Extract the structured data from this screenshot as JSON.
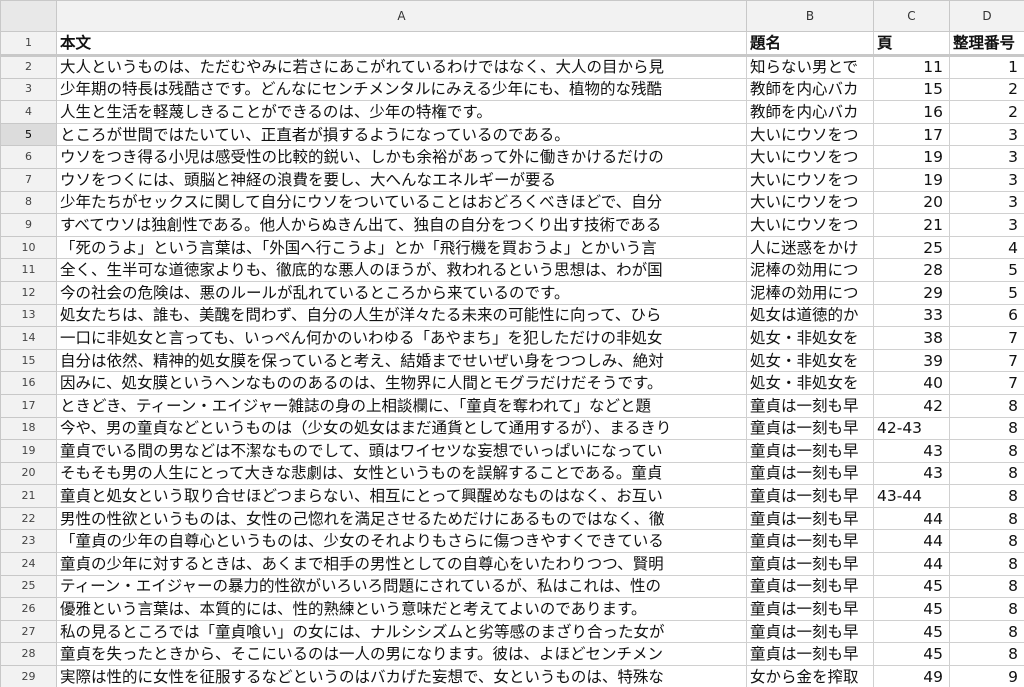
{
  "column_headers": [
    "A",
    "B",
    "C",
    "D"
  ],
  "header_row": {
    "row": "1",
    "a": "本文",
    "b": "題名",
    "c": "頁",
    "d": "整理番号"
  },
  "rows": [
    {
      "row": "2",
      "a": "大人というものは、ただむやみに若さにあこがれているわけではなく、大人の目から見",
      "b": "知らない男とで",
      "c": "11",
      "d": "1"
    },
    {
      "row": "3",
      "a": "少年期の特長は残酷さです。どんなにセンチメンタルにみえる少年にも、植物的な残酷",
      "b": "教師を内心バカ",
      "c": "15",
      "d": "2"
    },
    {
      "row": "4",
      "a": "人生と生活を軽蔑しきることができるのは、少年の特権です。",
      "b": "教師を内心バカ",
      "c": "16",
      "d": "2"
    },
    {
      "row": "5",
      "a": "ところが世間ではたいてい、正直者が損するようになっているのである。",
      "b": "大いにウソをつ",
      "c": "17",
      "d": "3"
    },
    {
      "row": "6",
      "a": "ウソをつき得る小児は感受性の比較的鋭い、しかも余裕があって外に働きかけるだけの",
      "b": "大いにウソをつ",
      "c": "19",
      "d": "3"
    },
    {
      "row": "7",
      "a": "ウソをつくには、頭脳と神経の浪費を要し、大へんなエネルギーが要る",
      "b": "大いにウソをつ",
      "c": "19",
      "d": "3"
    },
    {
      "row": "8",
      "a": "少年たちがセックスに関して自分にウソをついていることはおどろくべきほどで、自分",
      "b": "大いにウソをつ",
      "c": "20",
      "d": "3"
    },
    {
      "row": "9",
      "a": "すべてウソは独創性である。他人からぬきん出て、独自の自分をつくり出す技術である",
      "b": "大いにウソをつ",
      "c": "21",
      "d": "3"
    },
    {
      "row": "10",
      "a": "「死のうよ」という言葉は、「外国へ行こうよ」とか「飛行機を買おうよ」とかいう言",
      "b": "人に迷惑をかけ",
      "c": "25",
      "d": "4"
    },
    {
      "row": "11",
      "a": "全く、生半可な道徳家よりも、徹底的な悪人のほうが、救われるという思想は、わが国",
      "b": "泥棒の効用につ",
      "c": "28",
      "d": "5"
    },
    {
      "row": "12",
      "a": "今の社会の危険は、悪のルールが乱れているところから来ているのです。",
      "b": "泥棒の効用につ",
      "c": "29",
      "d": "5"
    },
    {
      "row": "13",
      "a": "処女たちは、誰も、美醜を問わず、自分の人生が洋々たる未来の可能性に向って、ひら",
      "b": "処女は道徳的か",
      "c": "33",
      "d": "6"
    },
    {
      "row": "14",
      "a": "一口に非処女と言っても、いっぺん何かのいわゆる「あやまち」を犯しただけの非処女",
      "b": "処女・非処女を",
      "c": "38",
      "d": "7"
    },
    {
      "row": "15",
      "a": "自分は依然、精神的処女膜を保っていると考え、結婚までせいぜい身をつつしみ、絶対",
      "b": "処女・非処女を",
      "c": "39",
      "d": "7"
    },
    {
      "row": "16",
      "a": "因みに、処女膜というヘンなもののあるのは、生物界に人間とモグラだけだそうです。",
      "b": "処女・非処女を",
      "c": "40",
      "d": "7"
    },
    {
      "row": "17",
      "a": "ときどき、ティーン・エイジャー雑誌の身の上相談欄に、「童貞を奪われて」などと題",
      "b": "童貞は一刻も早",
      "c": "42",
      "d": "8"
    },
    {
      "row": "18",
      "a": "今や、男の童貞などというものは（少女の処女はまだ通貨として通用するが）、まるきり",
      "b": "童貞は一刻も早",
      "c": "42-43",
      "d": "8"
    },
    {
      "row": "19",
      "a": "童貞でいる間の男などは不潔なものでして、頭はワイセツな妄想でいっぱいになってい",
      "b": "童貞は一刻も早",
      "c": "43",
      "d": "8"
    },
    {
      "row": "20",
      "a": "そもそも男の人生にとって大きな悲劇は、女性というものを誤解することである。童貞",
      "b": "童貞は一刻も早",
      "c": "43",
      "d": "8"
    },
    {
      "row": "21",
      "a": "童貞と処女という取り合せほどつまらない、相互にとって興醒めなものはなく、お互い",
      "b": "童貞は一刻も早",
      "c": "43-44",
      "d": "8"
    },
    {
      "row": "22",
      "a": "男性の性欲というものは、女性の己惚れを満足させるためだけにあるものではなく、徹",
      "b": "童貞は一刻も早",
      "c": "44",
      "d": "8"
    },
    {
      "row": "23",
      "a": "「童貞の少年の自尊心というものは、少女のそれよりもさらに傷つきやすくできている",
      "b": "童貞は一刻も早",
      "c": "44",
      "d": "8"
    },
    {
      "row": "24",
      "a": "童貞の少年に対するときは、あくまで相手の男性としての自尊心をいたわりつつ、賢明",
      "b": "童貞は一刻も早",
      "c": "44",
      "d": "8"
    },
    {
      "row": "25",
      "a": "ティーン・エイジャーの暴力的性欲がいろいろ問題にされているが、私はこれは、性の",
      "b": "童貞は一刻も早",
      "c": "45",
      "d": "8"
    },
    {
      "row": "26",
      "a": "優雅という言葉は、本質的には、性的熟練という意味だと考えてよいのであります。",
      "b": "童貞は一刻も早",
      "c": "45",
      "d": "8"
    },
    {
      "row": "27",
      "a": "私の見るところでは「童貞喰い」の女には、ナルシシズムと劣等感のまざり合った女が",
      "b": "童貞は一刻も早",
      "c": "45",
      "d": "8"
    },
    {
      "row": "28",
      "a": "童貞を失ったときから、そこにいるのは一人の男になります。彼は、よほどセンチメン",
      "b": "童貞は一刻も早",
      "c": "45",
      "d": "8"
    },
    {
      "row": "29",
      "a": "実際は性的に女性を征服するなどというのはバカげた妄想で、女というものは、特殊な",
      "b": "女から金を搾取",
      "c": "49",
      "d": "9"
    }
  ],
  "selected_row": "5"
}
